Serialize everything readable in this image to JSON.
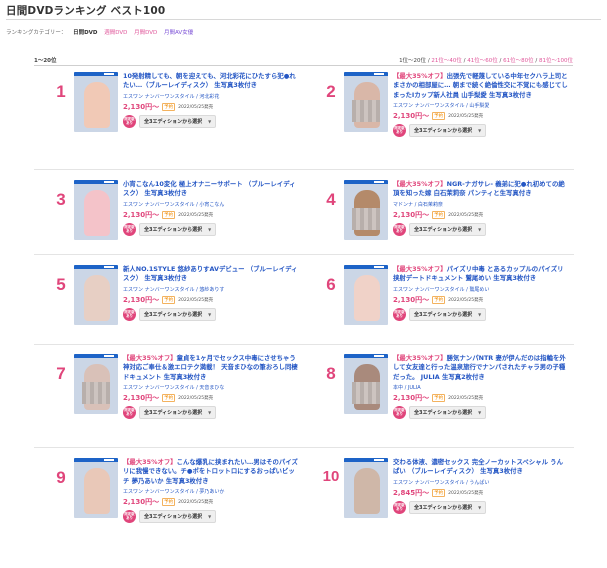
{
  "page": {
    "title": "日間DVDランキング ベスト100",
    "categories_label": "ランキングカテゴリー：",
    "categories": [
      "日間DVD",
      "週間DVD",
      "月間DVD",
      "月間AV女優"
    ],
    "range_label": "1〜20位",
    "pager": [
      "1位〜20位",
      "21位〜40位",
      "41位〜60位",
      "61位〜80位",
      "81位〜100位"
    ]
  },
  "common": {
    "preorder": "予約",
    "limited_badge_line1": "限定版",
    "limited_badge_line2": "あり",
    "select_label": "全3エディションから選択",
    "select_arrow": "▼"
  },
  "colors": {
    "accent": "#e0457b",
    "link": "#2456c4",
    "preorder": "#f08a00"
  },
  "items": [
    {
      "rank": "1",
      "offer": "",
      "title": "10発射精しても、朝を迎えても、河北彩花にひたすら犯●れたい…（ブルーレイディスク） 生写真3枚付き",
      "maker": "エスワン ナンバーワンスタイル / 河北彩花",
      "price": "2,130円〜",
      "date": "2022/05/25発売"
    },
    {
      "rank": "2",
      "offer": "【最大35%オフ】",
      "title": "出張先で軽蔑している中年セクハラ上司とまさかの相部屋に… 朝まで続く絶倫性交に不覚にも感じてしまったIカップ新人社員 山手梨愛 生写真3枚付き",
      "maker": "エスワン ナンバーワンスタイル / 山手梨愛",
      "price": "2,130円〜",
      "date": "2022/05/25発売"
    },
    {
      "rank": "3",
      "offer": "",
      "title": "小宵こなん10変化 極上オナニーサポート （ブルーレイディスク） 生写真3枚付き",
      "maker": "エスワン ナンバーワンスタイル / 小宵こなん",
      "price": "2,130円〜",
      "date": "2022/05/25発売"
    },
    {
      "rank": "4",
      "offer": "【最大35%オフ】",
      "title": "NGR-ナガサレ- 義弟に犯●れ初めての絶頂を知った嫁 白石茉莉奈 パンティと生写真付き",
      "maker": "マドンナ / 白石茉莉奈",
      "price": "2,130円〜",
      "date": "2022/05/25発売"
    },
    {
      "rank": "5",
      "offer": "",
      "title": "新人NO.1STYLE 悠紗ありすAVデビュー （ブルーレイディスク） 生写真3枚付き",
      "maker": "エスワン ナンバーワンスタイル / 悠紗ありす",
      "price": "2,130円〜",
      "date": "2022/05/25発売"
    },
    {
      "rank": "6",
      "offer": "【最大35%オフ】",
      "title": "パイズリ中毒 とあるカップルのパイズリ挟射デートドキュメント 鷲尾めい 生写真3枚付き",
      "maker": "エスワン ナンバーワンスタイル / 鷲尾めい",
      "price": "2,130円〜",
      "date": "2022/05/25発売"
    },
    {
      "rank": "7",
      "offer": "【最大35%オフ】",
      "title": "童貞を1ヶ月でセックス中毒にさせちゃう神対応ご奉仕＆激エロテク満載！ 天音まひなの筆おろし同棲ドキュメント 生写真3枚付き",
      "maker": "エスワン ナンバーワンスタイル / 天音まひな",
      "price": "2,130円〜",
      "date": "2022/05/25発売"
    },
    {
      "rank": "8",
      "offer": "【最大35%オフ】",
      "title": "勝気ナンパNTR 妻が伊んだのは指輪を外して女友達と行った温泉旅行でナンパされたチャラ男の子種だった。 JULIA 生写真2枚付き",
      "maker": "本中 / JULIA",
      "price": "2,130円〜",
      "date": "2022/05/25発売"
    },
    {
      "rank": "9",
      "offer": "【最大35%オフ】",
      "title": "こんな爆乳に挟まれたい…男はそのパイズリに我慢できない。チ●ポをトロットロにするおっぱいビッチ 夢乃あいか 生写真3枚付き",
      "maker": "エスワン ナンバーワンスタイル / 夢乃あいか",
      "price": "2,130円〜",
      "date": "2022/05/25発売"
    },
    {
      "rank": "10",
      "offer": "",
      "title": "交わる体液、濃密セックス 完全ノーカットスペシャル うんぱい （ブルーレイディスク） 生写真3枚付き",
      "maker": "エスワン ナンバーワンスタイル / うんぱい",
      "price": "2,845円〜",
      "date": "2022/05/25発売"
    }
  ]
}
